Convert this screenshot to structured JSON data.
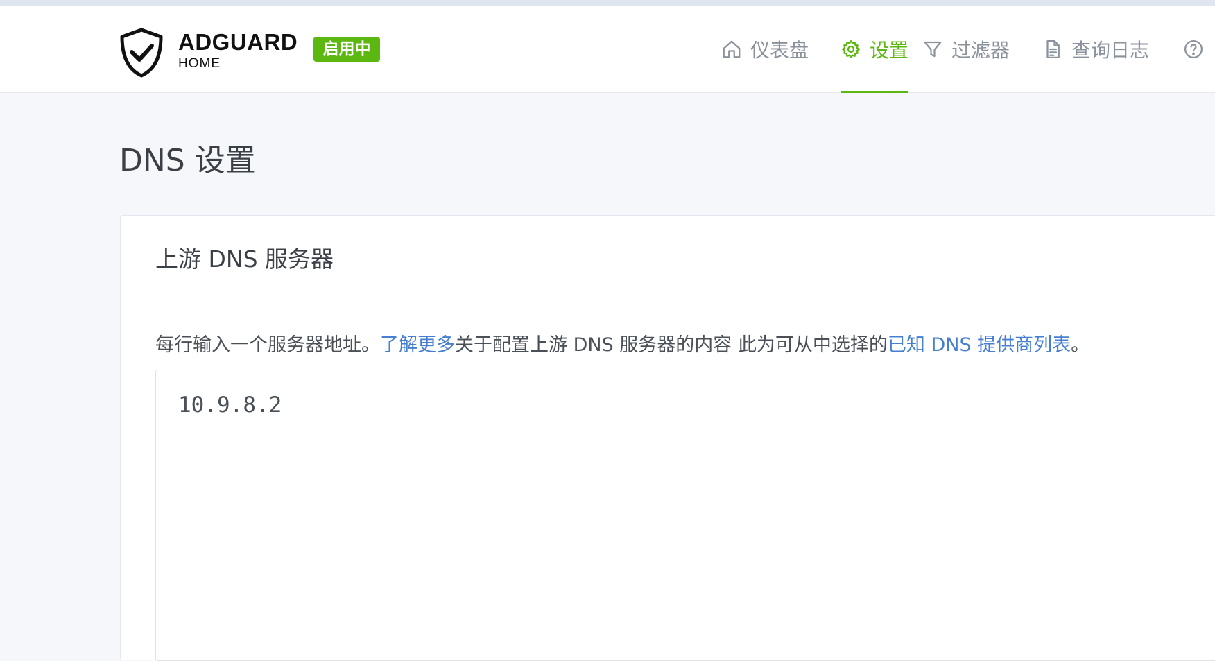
{
  "brand": {
    "name": "ADGUARD",
    "sub": "HOME",
    "status_badge": "启用中",
    "accent_color": "#5cb811"
  },
  "nav": {
    "items": [
      {
        "label": "仪表盘",
        "icon": "home-icon",
        "active": false
      },
      {
        "label": "设置",
        "icon": "gear-icon",
        "active": true
      },
      {
        "label": "过滤器",
        "icon": "filter-icon",
        "active": false
      },
      {
        "label": "查询日志",
        "icon": "document-icon",
        "active": false
      },
      {
        "label": "",
        "icon": "help-icon",
        "active": false
      }
    ]
  },
  "page": {
    "title": "DNS 设置"
  },
  "upstream": {
    "title": "上游 DNS 服务器",
    "desc_prefix": "每行输入一个服务器地址。",
    "learn_more_link": "了解更多",
    "desc_middle": "关于配置上游 DNS 服务器的内容 此为可从中选择的",
    "providers_link": "已知 DNS 提供商列表",
    "desc_suffix": "。",
    "value": "10.9.8.2",
    "link_color": "#467fcf"
  }
}
